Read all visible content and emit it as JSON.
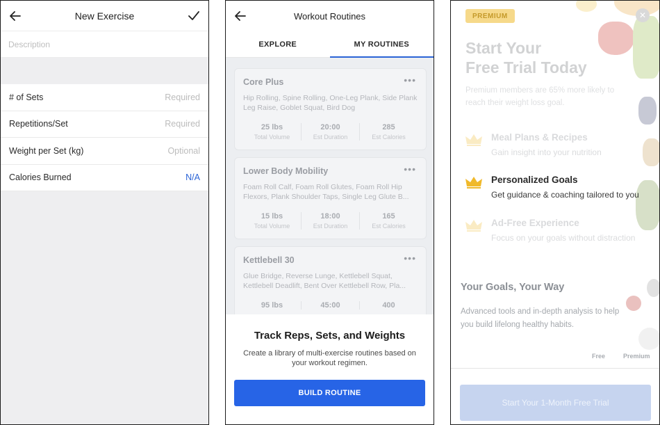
{
  "new_exercise": {
    "title": "New Exercise",
    "description_placeholder": "Description",
    "fields": [
      {
        "label": "# of Sets",
        "value": "Required"
      },
      {
        "label": "Repetitions/Set",
        "value": "Required"
      },
      {
        "label": "Weight per Set (kg)",
        "value": "Optional"
      },
      {
        "label": "Calories Burned",
        "value": "N/A"
      }
    ]
  },
  "workout_routines": {
    "title": "Workout Routines",
    "tabs": [
      "EXPLORE",
      "MY ROUTINES"
    ],
    "active_tab": "MY ROUTINES",
    "routines": [
      {
        "name": "Core Plus",
        "exercises": "Hip Rolling, Spine Rolling, One-Leg Plank, Side Plank Leg Raise, Goblet Squat, Bird Dog",
        "stats": [
          {
            "value": "25 lbs",
            "label": "Total Volume"
          },
          {
            "value": "20:00",
            "label": "Est Duration"
          },
          {
            "value": "285",
            "label": "Est Calories"
          }
        ]
      },
      {
        "name": "Lower Body Mobility",
        "exercises": "Foam Roll Calf, Foam Roll Glutes, Foam Roll Hip Flexors, Plank Shoulder Taps, Single Leg Glute B...",
        "stats": [
          {
            "value": "15 lbs",
            "label": "Total Volume"
          },
          {
            "value": "18:00",
            "label": "Est Duration"
          },
          {
            "value": "165",
            "label": "Est Calories"
          }
        ]
      },
      {
        "name": "Kettlebell 30",
        "exercises": "Glue Bridge, Reverse Lunge, Kettlebell Squat, Kettlebell Deadlift, Bent Over Kettlebell Row, Pla...",
        "stats": [
          {
            "value": "95 lbs",
            "label": ""
          },
          {
            "value": "45:00",
            "label": ""
          },
          {
            "value": "400",
            "label": ""
          }
        ]
      }
    ],
    "sheet": {
      "title": "Track Reps, Sets, and Weights",
      "description": "Create a library of multi-exercise routines based on your workout regimen.",
      "button": "BUILD ROUTINE"
    },
    "colors": {
      "accent": "#2764e6"
    }
  },
  "premium": {
    "badge": "PREMIUM",
    "title_line1": "Start Your",
    "title_line2": "Free Trial Today",
    "subtitle": "Premium members are 65% more likely to reach their weight loss goal.",
    "features": [
      {
        "title": "Meal Plans & Recipes",
        "desc": "Gain insight into your nutrition"
      },
      {
        "title": "Personalized Goals",
        "desc": "Get guidance & coaching tailored to you"
      },
      {
        "title": "Ad-Free Experience",
        "desc": "Focus on your goals without distraction"
      }
    ],
    "goals_title": "Your Goals, Your Way",
    "goals_desc": "Advanced tools and in-depth analysis to help you build lifelong healthy habits.",
    "col_free": "Free",
    "col_premium": "Premium",
    "button": "Start Your 1-Month Free Trial",
    "colors": {
      "crown": "#f0b92b"
    }
  }
}
